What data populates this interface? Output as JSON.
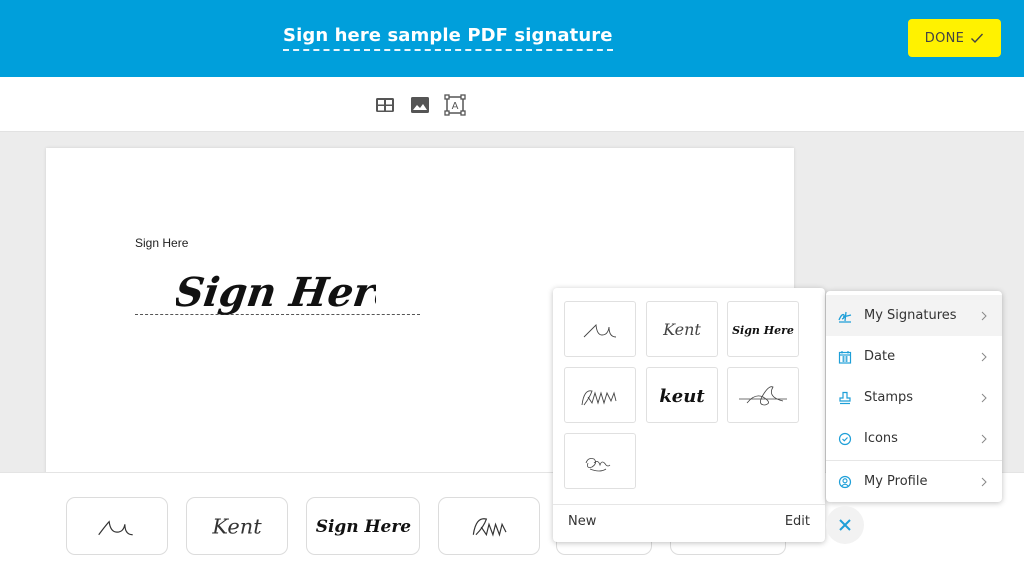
{
  "header": {
    "title": "Sign here sample PDF signature",
    "done_label": "DONE",
    "accent_color": "#009fdb",
    "done_color": "#fff200"
  },
  "toolbar": {
    "tools": [
      {
        "name": "table",
        "icon": "table-icon"
      },
      {
        "name": "image",
        "icon": "image-icon"
      },
      {
        "name": "text-box",
        "icon": "text-box-icon"
      }
    ]
  },
  "document": {
    "field_label": "Sign Here",
    "placed_signature": "Sign Here"
  },
  "signatures_popup": {
    "signatures": [
      {
        "id": "sig-1",
        "style": "scribble-u"
      },
      {
        "id": "sig-2",
        "style": "kent-thin"
      },
      {
        "id": "sig-3",
        "style": "sign-here"
      },
      {
        "id": "sig-4",
        "style": "scribble-mm"
      },
      {
        "id": "sig-5",
        "style": "kent-bold"
      },
      {
        "id": "sig-6",
        "style": "scribble-loop"
      },
      {
        "id": "sig-7",
        "style": "scribble-small"
      }
    ],
    "new_label": "New",
    "edit_label": "Edit"
  },
  "menu": {
    "items": [
      {
        "label": "My Signatures",
        "icon": "signature-icon",
        "active": true
      },
      {
        "label": "Date",
        "icon": "calendar-icon",
        "active": false
      },
      {
        "label": "Stamps",
        "icon": "stamp-icon",
        "active": false
      },
      {
        "label": "Icons",
        "icon": "check-circle-icon",
        "active": false
      },
      {
        "label": "My Profile",
        "icon": "profile-icon",
        "active": false
      }
    ],
    "icon_color": "#1e9fd8"
  },
  "bottom_bar": {
    "signatures": [
      "scribble-u",
      "kent-thin",
      "sign-here",
      "scribble-mm"
    ]
  }
}
